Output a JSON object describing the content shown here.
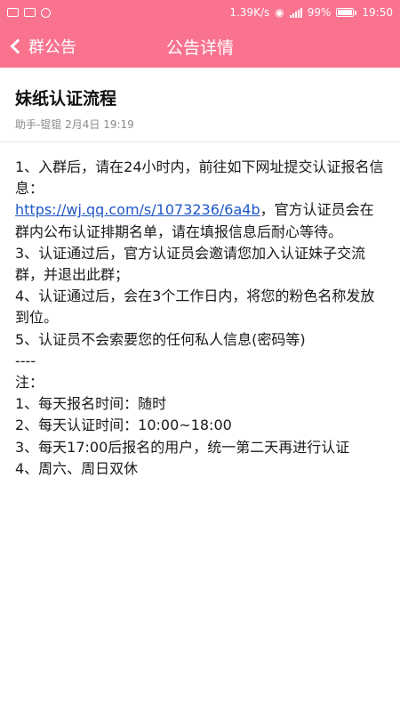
{
  "status_bar": {
    "left_icons": [
      "image-icon",
      "sim-icon",
      "record-icon"
    ],
    "net_speed": "1.39K/s",
    "battery_percent": "99%",
    "time": "19:50"
  },
  "nav": {
    "back_label": "群公告",
    "title": "公告详情"
  },
  "announcement": {
    "title": "妹纸认证流程",
    "meta": "助手-锟锟  2月4日 19:19",
    "body": {
      "line1": "1、入群后，请在24小时内，前往如下网址提交认证报名信息：",
      "link": "https://wj.qq.com/s/1073236/6a4b",
      "line2_after_link": "，官方认证员会在群内公布认证排期名单，请在填报信息后耐心等待。",
      "line3": "3、认证通过后，官方认证员会邀请您加入认证妹子交流群，并退出此群；",
      "line4": "4、认证通过后，会在3个工作日内，将您的粉色名称发放到位。",
      "line5": "5、认证员不会索要您的任何私人信息(密码等)",
      "divider": "----",
      "note_title": "注：",
      "notes": [
        "1、每天报名时间：随时",
        "2、每天认证时间：10:00~18:00",
        "3、每天17:00后报名的用户，统一第二天再进行认证",
        "4、周六、周日双休"
      ]
    }
  },
  "colors": {
    "accent": "#f9738f",
    "link": "#1f57c8"
  }
}
